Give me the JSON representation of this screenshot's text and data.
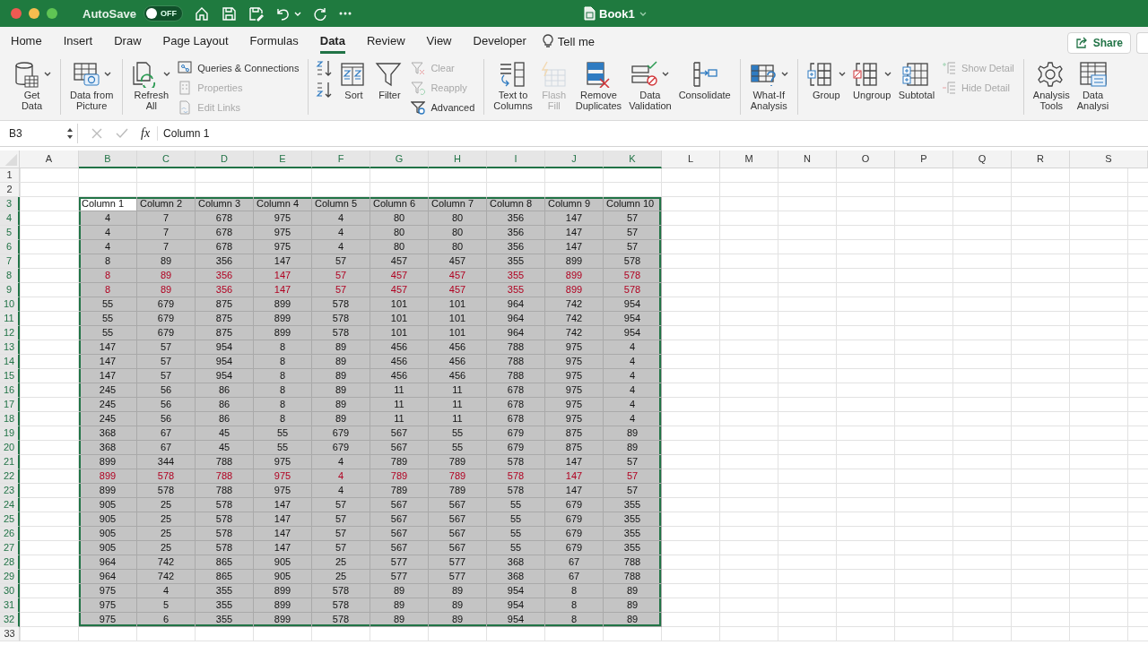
{
  "title_bar": {
    "autosave": {
      "label": "AutoSave",
      "on": false,
      "state_text": "OFF"
    },
    "title": "Book1"
  },
  "tabs": [
    {
      "label": "Home",
      "selected": false
    },
    {
      "label": "Insert",
      "selected": false
    },
    {
      "label": "Draw",
      "selected": false
    },
    {
      "label": "Page Layout",
      "selected": false
    },
    {
      "label": "Formulas",
      "selected": false
    },
    {
      "label": "Data",
      "selected": true
    },
    {
      "label": "Review",
      "selected": false
    },
    {
      "label": "View",
      "selected": false
    },
    {
      "label": "Developer",
      "selected": false
    }
  ],
  "tell_me": "Tell me",
  "share": "Share",
  "ribbon": [
    {
      "items": [
        {
          "kind": "large",
          "label": "Get\nData",
          "dropdown": true,
          "disabled": false
        }
      ]
    },
    {
      "items": [
        {
          "kind": "large",
          "label": "Data from\nPicture",
          "dropdown": true,
          "disabled": false
        }
      ]
    },
    {
      "items": [
        {
          "kind": "large",
          "label": "Refresh\nAll",
          "dropdown": true,
          "disabled": false
        },
        {
          "kind": "stack",
          "items": [
            {
              "label": "Queries & Connections",
              "disabled": false
            },
            {
              "label": "Properties",
              "disabled": true
            },
            {
              "label": "Edit Links",
              "disabled": true
            }
          ]
        }
      ]
    },
    {
      "items": [
        {
          "kind": "sort_buttons"
        },
        {
          "kind": "large",
          "label": "Sort",
          "dropdown": false,
          "disabled": false
        },
        {
          "kind": "large",
          "label": "Filter",
          "dropdown": false,
          "disabled": false
        },
        {
          "kind": "stack",
          "items": [
            {
              "label": "Clear",
              "disabled": true
            },
            {
              "label": "Reapply",
              "disabled": true
            },
            {
              "label": "Advanced",
              "disabled": false
            }
          ]
        }
      ]
    },
    {
      "items": [
        {
          "kind": "large",
          "label": "Text to\nColumns",
          "dropdown": false,
          "disabled": false
        },
        {
          "kind": "large",
          "label": "Flash\nFill",
          "dropdown": false,
          "disabled": true
        },
        {
          "kind": "large",
          "label": "Remove\nDuplicates",
          "dropdown": false,
          "disabled": false
        },
        {
          "kind": "large",
          "label": "Data\nValidation",
          "dropdown": true,
          "disabled": false
        },
        {
          "kind": "large",
          "label": "Consolidate",
          "dropdown": false,
          "disabled": false
        }
      ]
    },
    {
      "items": [
        {
          "kind": "large",
          "label": "What-If\nAnalysis",
          "dropdown": true,
          "disabled": false
        }
      ]
    },
    {
      "items": [
        {
          "kind": "large",
          "label": "Group",
          "dropdown": true,
          "disabled": false
        },
        {
          "kind": "large",
          "label": "Ungroup",
          "dropdown": true,
          "disabled": false
        },
        {
          "kind": "large",
          "label": "Subtotal",
          "dropdown": false,
          "disabled": false
        },
        {
          "kind": "stack",
          "items": [
            {
              "label": "Show Detail",
              "disabled": true
            },
            {
              "label": "Hide Detail",
              "disabled": true
            }
          ]
        }
      ]
    },
    {
      "items": [
        {
          "kind": "large",
          "label": "Analysis\nTools",
          "dropdown": false,
          "disabled": false
        },
        {
          "kind": "large",
          "label": "Data\nAnalysi",
          "dropdown": false,
          "disabled": false
        }
      ]
    }
  ],
  "formula_bar": {
    "name_box": "B3",
    "function_label": "fx",
    "formula": "Column 1"
  },
  "sheet": {
    "columns": [
      {
        "label": "A",
        "selected": false
      },
      {
        "label": "B",
        "selected": true
      },
      {
        "label": "C",
        "selected": true
      },
      {
        "label": "D",
        "selected": true
      },
      {
        "label": "E",
        "selected": true
      },
      {
        "label": "F",
        "selected": true
      },
      {
        "label": "G",
        "selected": true
      },
      {
        "label": "H",
        "selected": true
      },
      {
        "label": "I",
        "selected": true
      },
      {
        "label": "J",
        "selected": true
      },
      {
        "label": "K",
        "selected": true
      },
      {
        "label": "L",
        "selected": false
      },
      {
        "label": "M",
        "selected": false
      },
      {
        "label": "N",
        "selected": false
      },
      {
        "label": "O",
        "selected": false
      },
      {
        "label": "P",
        "selected": false
      },
      {
        "label": "Q",
        "selected": false
      },
      {
        "label": "R",
        "selected": false
      },
      {
        "label": "S",
        "selected": false
      }
    ],
    "rows": [
      {
        "label": "1",
        "selected": false,
        "highlighted": false
      },
      {
        "label": "2",
        "selected": false,
        "highlighted": false
      },
      {
        "label": "3",
        "selected": true,
        "highlighted": false,
        "kind": "header",
        "cells": [
          "Column 1",
          "Column 2",
          "Column 3",
          "Column 4",
          "Column 5",
          "Column 6",
          "Column 7",
          "Column 8",
          "Column 9",
          "Column 10"
        ]
      },
      {
        "label": "4",
        "selected": true,
        "highlighted": false,
        "cells": [
          "4",
          "7",
          "678",
          "975",
          "4",
          "80",
          "80",
          "356",
          "147",
          "57"
        ]
      },
      {
        "label": "5",
        "selected": true,
        "highlighted": false,
        "cells": [
          "4",
          "7",
          "678",
          "975",
          "4",
          "80",
          "80",
          "356",
          "147",
          "57"
        ]
      },
      {
        "label": "6",
        "selected": true,
        "highlighted": false,
        "cells": [
          "4",
          "7",
          "678",
          "975",
          "4",
          "80",
          "80",
          "356",
          "147",
          "57"
        ]
      },
      {
        "label": "7",
        "selected": true,
        "highlighted": false,
        "cells": [
          "8",
          "89",
          "356",
          "147",
          "57",
          "457",
          "457",
          "355",
          "899",
          "578"
        ]
      },
      {
        "label": "8",
        "selected": true,
        "highlighted": true,
        "cells": [
          "8",
          "89",
          "356",
          "147",
          "57",
          "457",
          "457",
          "355",
          "899",
          "578"
        ]
      },
      {
        "label": "9",
        "selected": true,
        "highlighted": true,
        "cells": [
          "8",
          "89",
          "356",
          "147",
          "57",
          "457",
          "457",
          "355",
          "899",
          "578"
        ]
      },
      {
        "label": "10",
        "selected": true,
        "highlighted": false,
        "cells": [
          "55",
          "679",
          "875",
          "899",
          "578",
          "101",
          "101",
          "964",
          "742",
          "954"
        ]
      },
      {
        "label": "11",
        "selected": true,
        "highlighted": false,
        "cells": [
          "55",
          "679",
          "875",
          "899",
          "578",
          "101",
          "101",
          "964",
          "742",
          "954"
        ]
      },
      {
        "label": "12",
        "selected": true,
        "highlighted": false,
        "cells": [
          "55",
          "679",
          "875",
          "899",
          "578",
          "101",
          "101",
          "964",
          "742",
          "954"
        ]
      },
      {
        "label": "13",
        "selected": true,
        "highlighted": false,
        "cells": [
          "147",
          "57",
          "954",
          "8",
          "89",
          "456",
          "456",
          "788",
          "975",
          "4"
        ]
      },
      {
        "label": "14",
        "selected": true,
        "highlighted": false,
        "cells": [
          "147",
          "57",
          "954",
          "8",
          "89",
          "456",
          "456",
          "788",
          "975",
          "4"
        ]
      },
      {
        "label": "15",
        "selected": true,
        "highlighted": false,
        "cells": [
          "147",
          "57",
          "954",
          "8",
          "89",
          "456",
          "456",
          "788",
          "975",
          "4"
        ]
      },
      {
        "label": "16",
        "selected": true,
        "highlighted": false,
        "cells": [
          "245",
          "56",
          "86",
          "8",
          "89",
          "11",
          "11",
          "678",
          "975",
          "4"
        ]
      },
      {
        "label": "17",
        "selected": true,
        "highlighted": false,
        "cells": [
          "245",
          "56",
          "86",
          "8",
          "89",
          "11",
          "11",
          "678",
          "975",
          "4"
        ]
      },
      {
        "label": "18",
        "selected": true,
        "highlighted": false,
        "cells": [
          "245",
          "56",
          "86",
          "8",
          "89",
          "11",
          "11",
          "678",
          "975",
          "4"
        ]
      },
      {
        "label": "19",
        "selected": true,
        "highlighted": false,
        "cells": [
          "368",
          "67",
          "45",
          "55",
          "679",
          "567",
          "55",
          "679",
          "875",
          "89"
        ]
      },
      {
        "label": "20",
        "selected": true,
        "highlighted": false,
        "cells": [
          "368",
          "67",
          "45",
          "55",
          "679",
          "567",
          "55",
          "679",
          "875",
          "89"
        ]
      },
      {
        "label": "21",
        "selected": true,
        "highlighted": false,
        "cells": [
          "899",
          "344",
          "788",
          "975",
          "4",
          "789",
          "789",
          "578",
          "147",
          "57"
        ]
      },
      {
        "label": "22",
        "selected": true,
        "highlighted": true,
        "cells": [
          "899",
          "578",
          "788",
          "975",
          "4",
          "789",
          "789",
          "578",
          "147",
          "57"
        ]
      },
      {
        "label": "23",
        "selected": true,
        "highlighted": false,
        "cells": [
          "899",
          "578",
          "788",
          "975",
          "4",
          "789",
          "789",
          "578",
          "147",
          "57"
        ]
      },
      {
        "label": "24",
        "selected": true,
        "highlighted": false,
        "cells": [
          "905",
          "25",
          "578",
          "147",
          "57",
          "567",
          "567",
          "55",
          "679",
          "355"
        ]
      },
      {
        "label": "25",
        "selected": true,
        "highlighted": false,
        "cells": [
          "905",
          "25",
          "578",
          "147",
          "57",
          "567",
          "567",
          "55",
          "679",
          "355"
        ]
      },
      {
        "label": "26",
        "selected": true,
        "highlighted": false,
        "cells": [
          "905",
          "25",
          "578",
          "147",
          "57",
          "567",
          "567",
          "55",
          "679",
          "355"
        ]
      },
      {
        "label": "27",
        "selected": true,
        "highlighted": false,
        "cells": [
          "905",
          "25",
          "578",
          "147",
          "57",
          "567",
          "567",
          "55",
          "679",
          "355"
        ]
      },
      {
        "label": "28",
        "selected": true,
        "highlighted": false,
        "cells": [
          "964",
          "742",
          "865",
          "905",
          "25",
          "577",
          "577",
          "368",
          "67",
          "788"
        ]
      },
      {
        "label": "29",
        "selected": true,
        "highlighted": false,
        "cells": [
          "964",
          "742",
          "865",
          "905",
          "25",
          "577",
          "577",
          "368",
          "67",
          "788"
        ]
      },
      {
        "label": "30",
        "selected": true,
        "highlighted": false,
        "cells": [
          "975",
          "4",
          "355",
          "899",
          "578",
          "89",
          "89",
          "954",
          "8",
          "89"
        ]
      },
      {
        "label": "31",
        "selected": true,
        "highlighted": false,
        "cells": [
          "975",
          "5",
          "355",
          "899",
          "578",
          "89",
          "89",
          "954",
          "8",
          "89"
        ]
      },
      {
        "label": "32",
        "selected": true,
        "highlighted": false,
        "cells": [
          "975",
          "6",
          "355",
          "899",
          "578",
          "89",
          "89",
          "954",
          "8",
          "89"
        ]
      },
      {
        "label": "33",
        "selected": false,
        "highlighted": false
      }
    ]
  }
}
